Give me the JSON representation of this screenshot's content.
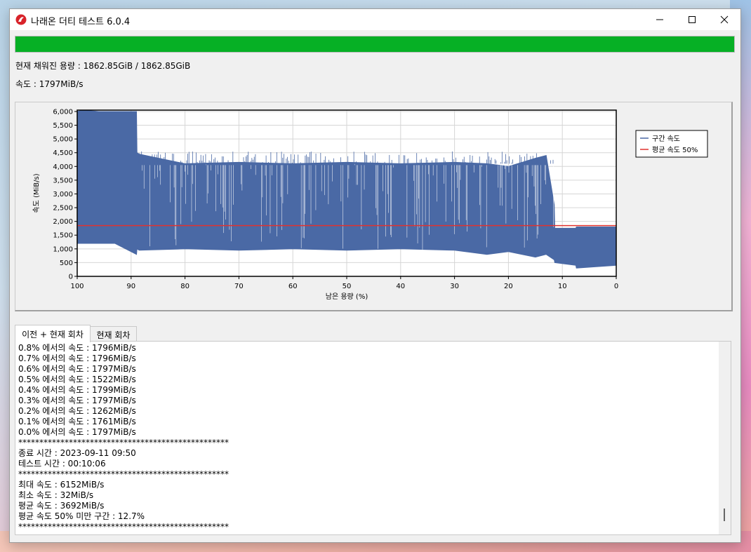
{
  "window": {
    "title": "나래온 더티 테스트 6.0.4"
  },
  "progress": {
    "percent": 100,
    "color": "#06b025"
  },
  "info": {
    "filled": "현재 채워진 용량 : 1862.85GiB / 1862.85GiB",
    "speed": "속도 : 1797MiB/s"
  },
  "chart_data": {
    "type": "area",
    "ylabel": "속도  (MiB/s)",
    "xlabel": "남은 용량 (%)",
    "ylim": [
      0,
      6000
    ],
    "xlim": [
      100,
      0
    ],
    "yticks": [
      "6,000",
      "5,500",
      "5,000",
      "4,500",
      "4,000",
      "3,500",
      "3,000",
      "2,500",
      "2,000",
      "1,500",
      "1,000",
      "500",
      "0"
    ],
    "xticks": [
      "100",
      "90",
      "80",
      "70",
      "60",
      "50",
      "40",
      "30",
      "20",
      "10",
      "0"
    ],
    "grid": true,
    "legend_position": "right",
    "series": [
      {
        "name": "구간 속도",
        "color": "#4a69a5",
        "x": [
          100,
          99,
          96,
          93,
          89,
          88.9,
          88.5,
          80,
          70,
          60,
          50,
          40,
          30,
          24,
          20,
          15,
          13,
          11.5,
          11.4,
          7.5,
          7.4,
          0
        ],
        "y_high": [
          6000,
          6050,
          6000,
          6000,
          6000,
          4500,
          4450,
          4100,
          4150,
          4100,
          4150,
          4100,
          4150,
          4100,
          4000,
          4300,
          4400,
          2600,
          1750,
          1750,
          1800,
          1800
        ],
        "y_low": [
          1200,
          1200,
          1200,
          1200,
          800,
          1000,
          950,
          1000,
          950,
          1000,
          950,
          1000,
          950,
          800,
          900,
          700,
          800,
          600,
          500,
          400,
          300,
          400
        ]
      },
      {
        "name": "평균 속도 50%",
        "color": "#e0322f",
        "x": [
          100,
          0
        ],
        "y": [
          1846,
          1846
        ]
      }
    ]
  },
  "tabs": [
    {
      "label": "이전 + 현재 회차",
      "active": true
    },
    {
      "label": "현재 회차",
      "active": false
    }
  ],
  "log": [
    "0.8% 에서의 속도 : 1796MiB/s",
    "0.7% 에서의 속도 : 1796MiB/s",
    "0.6% 에서의 속도 : 1797MiB/s",
    "0.5% 에서의 속도 : 1522MiB/s",
    "0.4% 에서의 속도 : 1799MiB/s",
    "0.3% 에서의 속도 : 1797MiB/s",
    "0.2% 에서의 속도 : 1262MiB/s",
    "0.1% 에서의 속도 : 1761MiB/s",
    "0.0% 에서의 속도 : 1797MiB/s",
    "**************************************************",
    "종료 시간 : 2023-09-11 09:50",
    "테스트 시간 : 00:10:06",
    "**************************************************",
    "최대 속도 : 6152MiB/s",
    "최소 속도 : 32MiB/s",
    "평균 속도 : 3692MiB/s",
    "평균 속도 50% 미만 구간 : 12.7%",
    "**************************************************"
  ]
}
